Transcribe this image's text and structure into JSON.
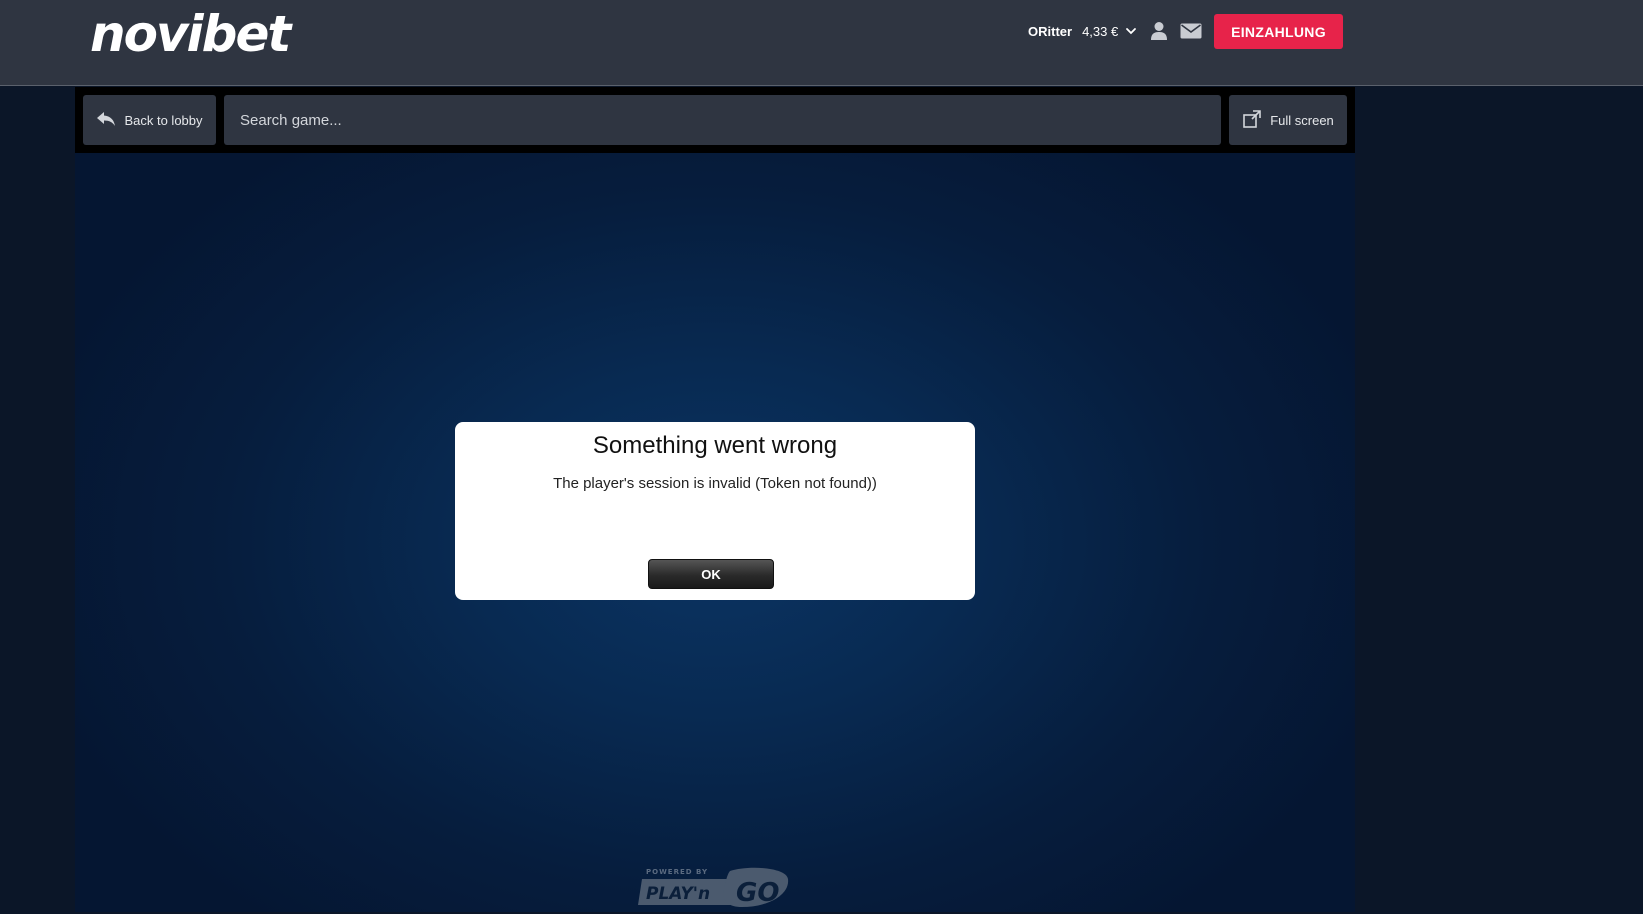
{
  "header": {
    "logo_text": "novibet",
    "username": "ORitter",
    "balance": "4,33 €",
    "deposit_label": "EINZAHLUNG",
    "icons": {
      "balance_toggle": "chevron-down-icon",
      "account": "user-icon",
      "messages": "mail-icon"
    },
    "colors": {
      "header_bg": "#2f3541",
      "deposit_bg": "#e7234a"
    }
  },
  "toolbar": {
    "back_label": "Back to lobby",
    "search_placeholder": "Search game...",
    "fullscreen_label": "Full screen",
    "icons": {
      "back": "reply-arrow-icon",
      "fullscreen": "fullscreen-icon"
    }
  },
  "dialog": {
    "title": "Something went wrong",
    "message": "The player's session is invalid (Token not found))",
    "ok_label": "OK"
  },
  "provider": {
    "powered_by": "POWERED BY",
    "name": "PLAY'n GO"
  }
}
